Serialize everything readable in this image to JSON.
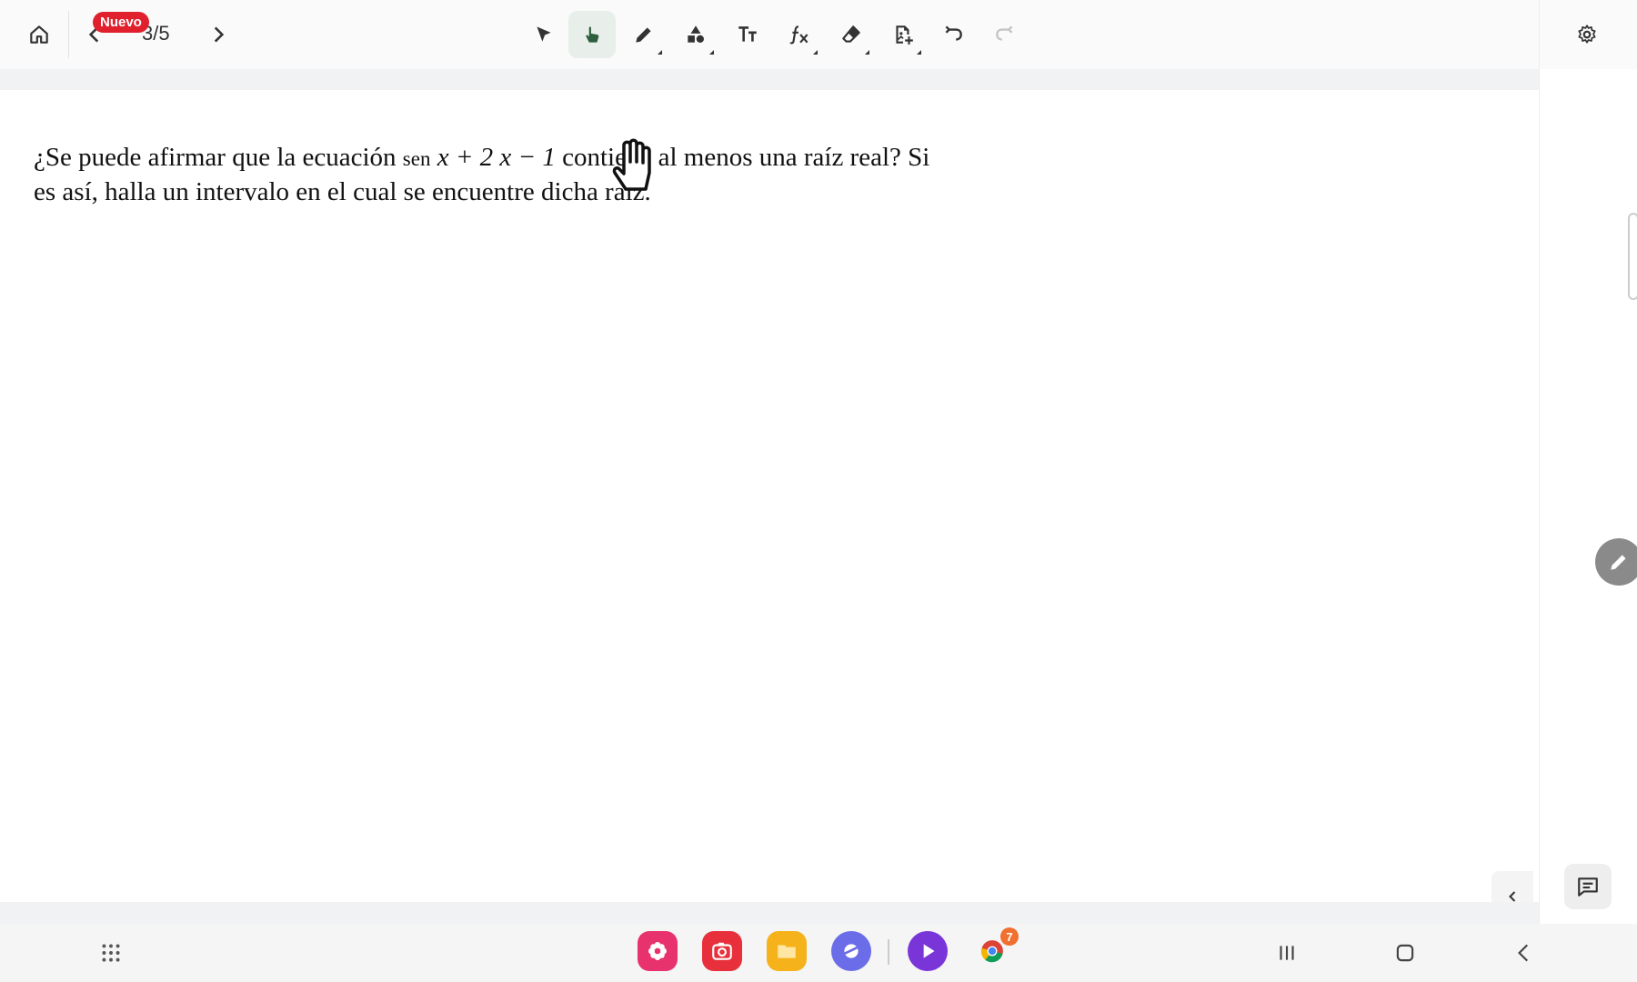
{
  "toolbar": {
    "page_counter": "3/5",
    "new_badge": "Nuevo",
    "tools": [
      "select-tool",
      "hand-tool",
      "pen-tool",
      "shapes-tool",
      "text-tool",
      "formula-tool",
      "eraser-tool",
      "insert-image-tool",
      "undo",
      "redo"
    ],
    "active_tool": "hand-tool"
  },
  "question": {
    "part1": "¿Se puede afirmar que la ecuación ",
    "fn": "sen",
    "expr": " x + 2 x − 1",
    "part2": " contiene al menos una raíz real? Si",
    "line2": "es así, halla un intervalo en el cual se encuentre dicha raíz."
  },
  "dock": {
    "apps": [
      "flower-app",
      "camera-app",
      "files-app",
      "internet-app",
      "video-player-app",
      "chrome-app"
    ],
    "chrome_badge": "7"
  },
  "colors": {
    "accent_active": "#e8eeea",
    "badge_red": "#e0202d",
    "hand_green": "#2e5e3e"
  }
}
